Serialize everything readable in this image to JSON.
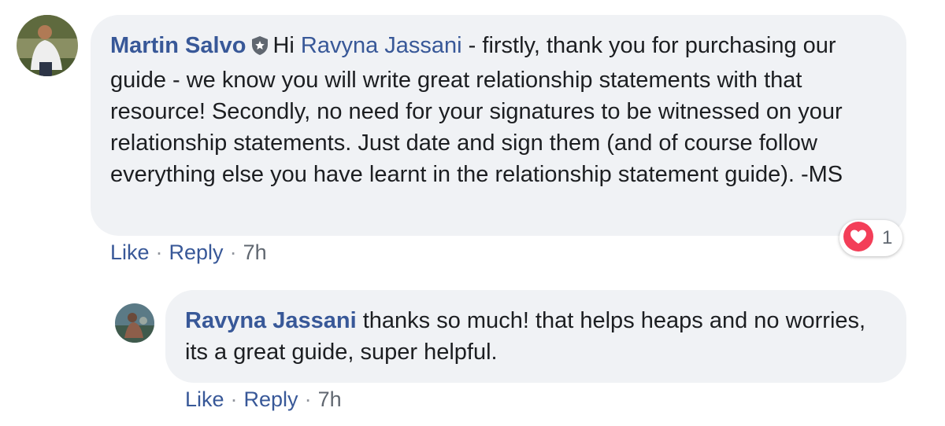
{
  "comment": {
    "author": "Martin Salvo",
    "greeting": "Hi",
    "mention": "Ravyna Jassani",
    "text": " - firstly, thank you for purchasing our guide - we know you will write great relationship statements with that resource! Secondly, no need for your signatures to be witnessed on your relationship statements. Just date and sign them (and of course follow everything else you have learnt in the relationship statement guide). -MS",
    "like_label": "Like",
    "reply_label": "Reply",
    "separator": "·",
    "timestamp": "7h",
    "reaction": {
      "icon": "heart-icon",
      "count": "1",
      "color": "#f33e58"
    },
    "badge_icon": "shield-star-icon"
  },
  "reply": {
    "author": "Ravyna Jassani",
    "text": "thanks so much! that helps heaps and no worries, its a great guide, super helpful.",
    "like_label": "Like",
    "reply_label": "Reply",
    "separator": "·",
    "timestamp": "7h"
  },
  "colors": {
    "name_blue": "#385898",
    "bubble_bg": "#f0f2f5",
    "text": "#1c1e21",
    "meta_gray": "#606770"
  }
}
